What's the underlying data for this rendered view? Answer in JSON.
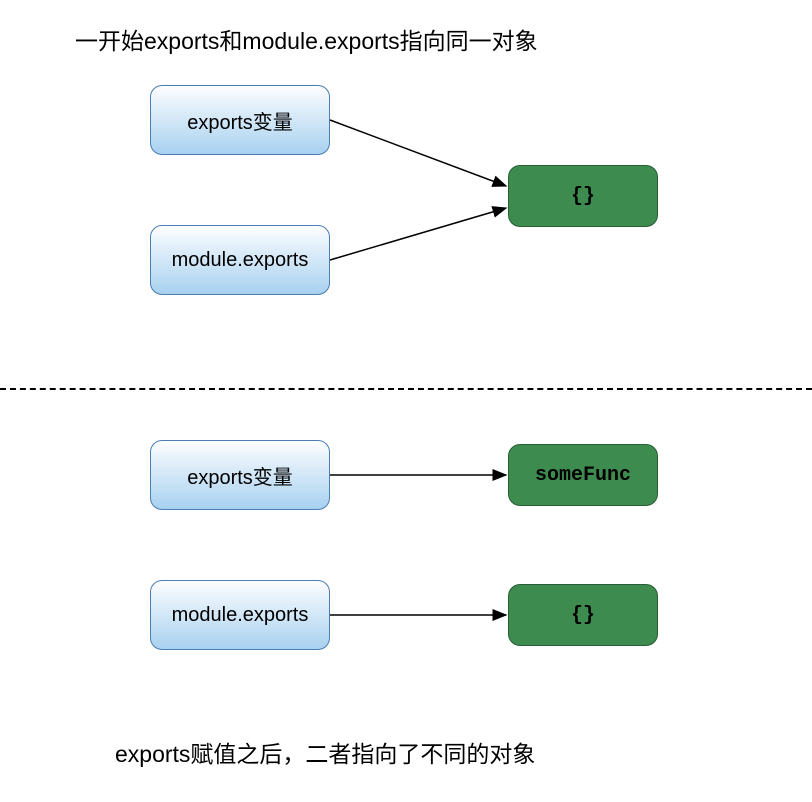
{
  "diagram": {
    "title_top": "一开始exports和module.exports指向同一对象",
    "title_bottom": "exports赋值之后，二者指向了不同的对象",
    "top": {
      "box1": "exports变量",
      "box2": "module.exports",
      "target": "{}"
    },
    "bottom": {
      "box1": "exports变量",
      "target1": "someFunc",
      "box2": "module.exports",
      "target2": "{}"
    }
  }
}
